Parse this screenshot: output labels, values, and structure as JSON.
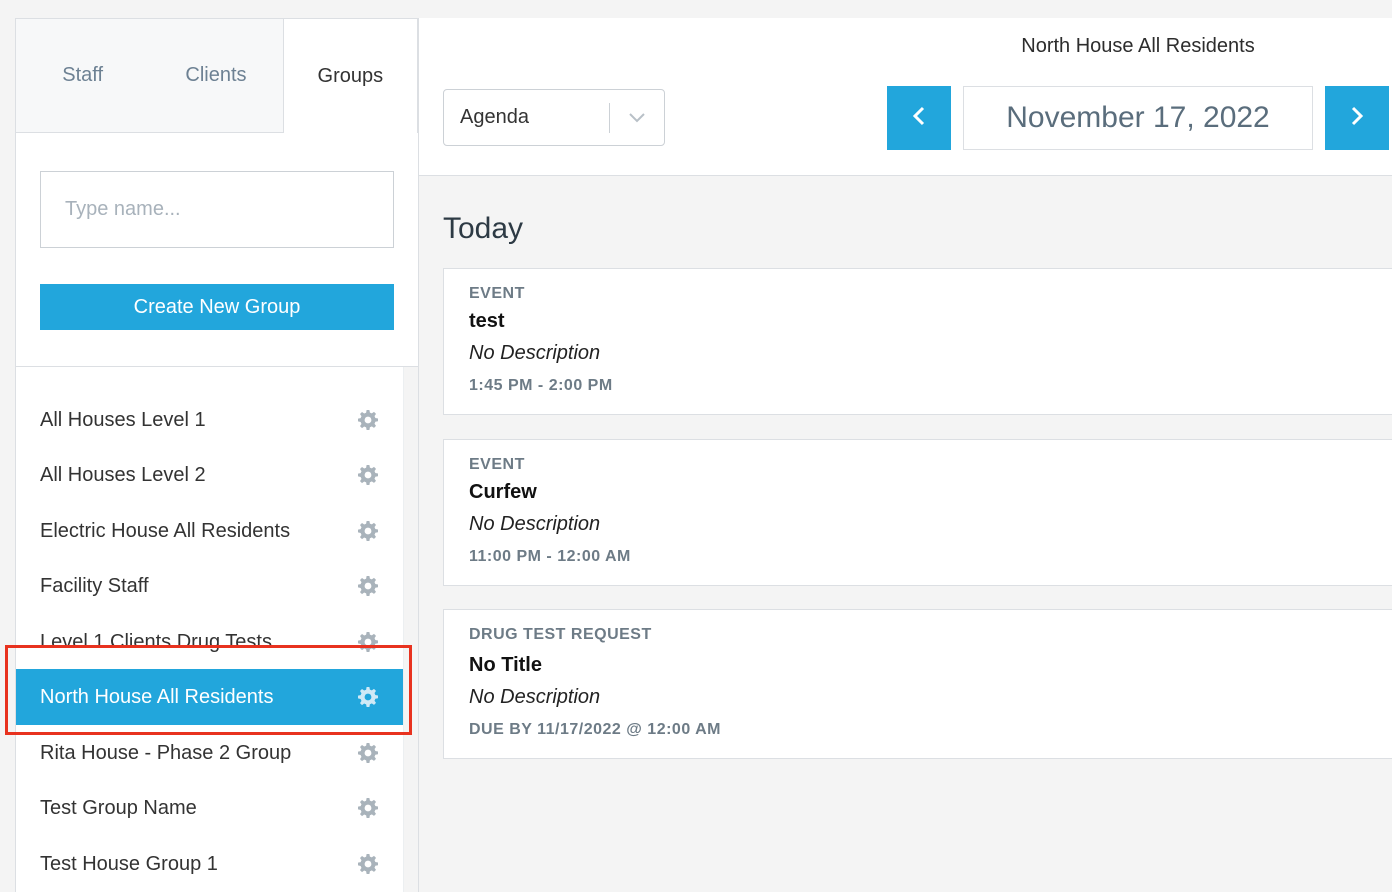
{
  "sidebar": {
    "tabs": [
      {
        "label": "Staff"
      },
      {
        "label": "Clients"
      },
      {
        "label": "Groups"
      }
    ],
    "search": {
      "placeholder": "Type name...",
      "value": ""
    },
    "create_button": "Create New Group",
    "groups": [
      {
        "label": "All Houses Level 1"
      },
      {
        "label": "All Houses Level 2"
      },
      {
        "label": "Electric House All Residents"
      },
      {
        "label": "Facility Staff"
      },
      {
        "label": "Level 1 Clients Drug Tests"
      },
      {
        "label": "North House All Residents",
        "active": true
      },
      {
        "label": "Rita House - Phase 2 Group"
      },
      {
        "label": "Test Group Name"
      },
      {
        "label": "Test House Group 1"
      }
    ]
  },
  "header": {
    "calendar_title": "North House All Residents",
    "view_select": {
      "selected": "Agenda"
    },
    "date": "November 17, 2022"
  },
  "agenda": {
    "section_title": "Today",
    "events": [
      {
        "type": "EVENT",
        "title": "test",
        "description": "No Description",
        "time": "1:45 PM - 2:00 PM"
      },
      {
        "type": "EVENT",
        "title": "Curfew",
        "description": "No Description",
        "time": "11:00 PM - 12:00 AM"
      },
      {
        "type": "DRUG TEST REQUEST",
        "title": "No Title",
        "description": "No Description",
        "time": "DUE BY 11/17/2022 @ 12:00 AM"
      }
    ]
  },
  "colors": {
    "accent": "#22a6dc",
    "highlight": "#e8321f"
  }
}
